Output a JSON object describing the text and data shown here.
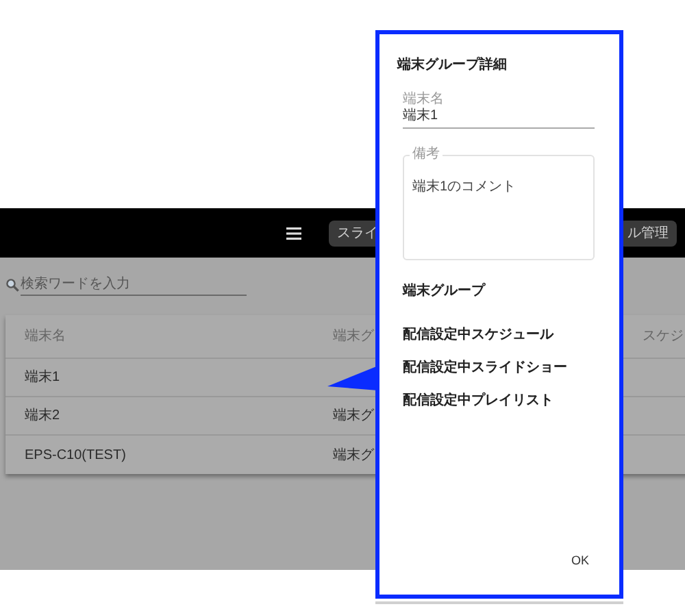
{
  "app": {
    "header": {
      "buttons": [
        "スライ",
        "ル管理"
      ]
    },
    "search": {
      "placeholder": "検索ワードを入力"
    },
    "table": {
      "columns": [
        "端末名",
        "端末グ",
        "スケジ"
      ],
      "rows": [
        {
          "name": "端末1"
        },
        {
          "name": "端末2",
          "column_2": "端末グ"
        },
        {
          "name": "EPS-C10(TEST)",
          "column_2": "端末グ"
        }
      ]
    }
  },
  "dialog": {
    "title": "端末グループ詳細",
    "fields": [
      {
        "kind": "line",
        "label": "端末名",
        "value": "端末1"
      },
      {
        "kind": "area",
        "label": "備考",
        "value": "端末1のコメント"
      }
    ],
    "sections": [
      "端末グループ",
      "配信設定中スケジュール",
      "配信設定中スライドショー",
      "配信設定中プレイリスト"
    ],
    "button": "OK"
  }
}
